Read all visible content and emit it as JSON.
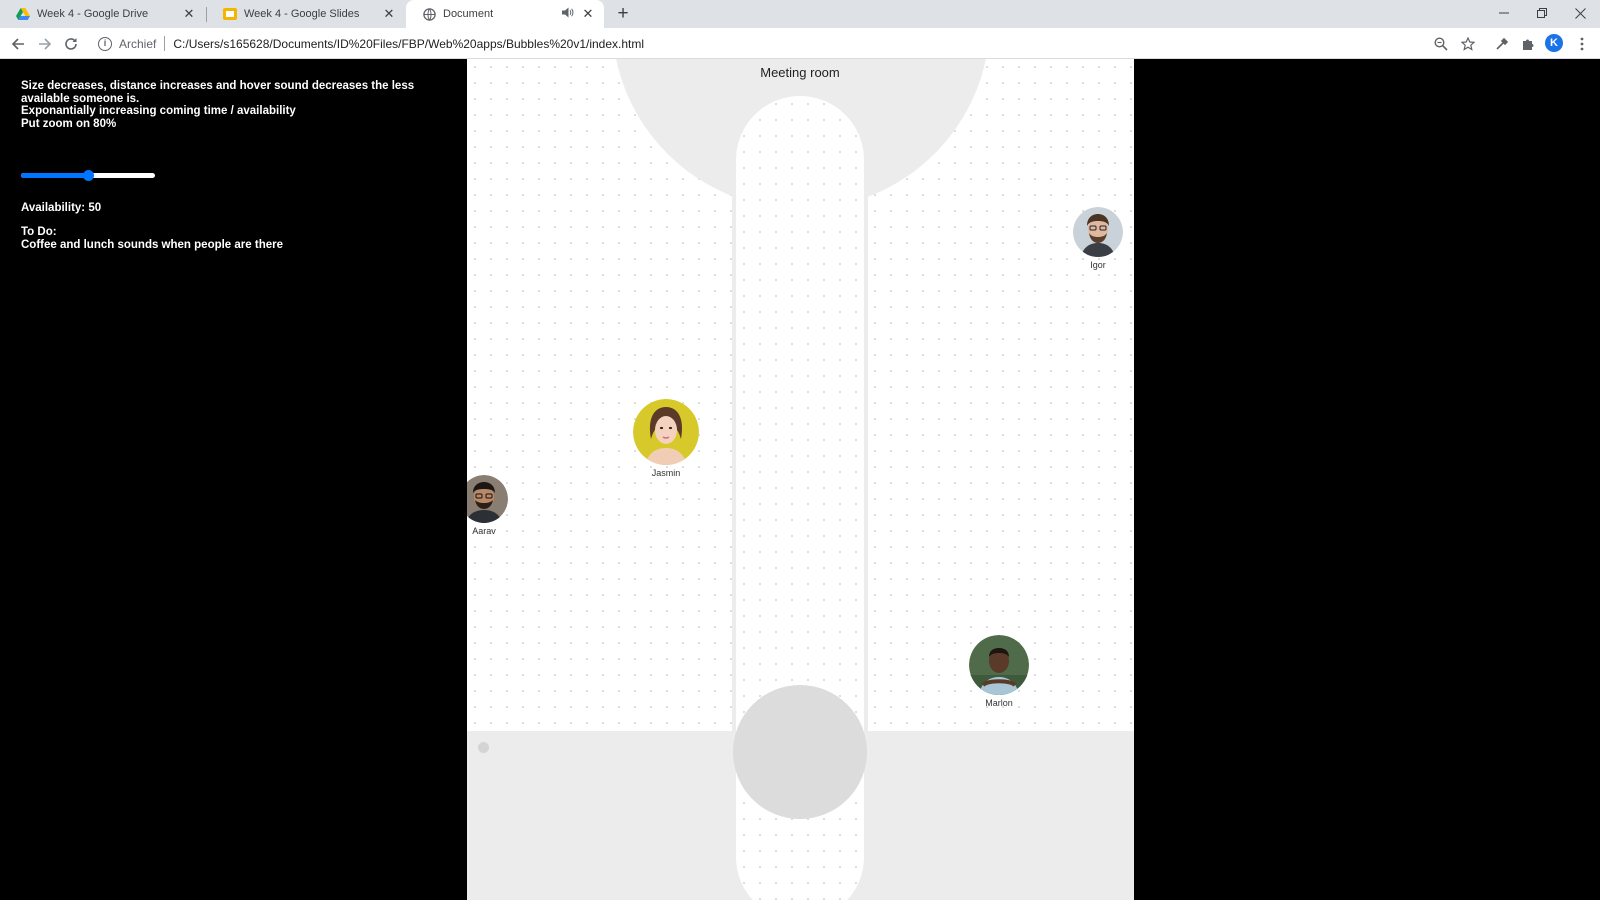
{
  "browser": {
    "tabs": [
      {
        "title": "Week 4 - Google Drive",
        "icon": "google-drive-icon",
        "active": false
      },
      {
        "title": "Week 4 - Google Slides",
        "icon": "google-slides-icon",
        "active": false
      },
      {
        "title": "Document",
        "icon": "globe-icon",
        "active": true
      }
    ],
    "address": {
      "security_label": "Archief",
      "url": "C:/Users/s165628/Documents/ID%20Files/FBP/Web%20apps/Bubbles%20v1/index.html"
    },
    "profile_initial": "K"
  },
  "info_panel": {
    "lines": [
      "Size decreases, distance increases and hover sound decreases the less available someone is.",
      "Exponantially increasing coming time / availability",
      "Put zoom on 80%"
    ]
  },
  "slider": {
    "value": 50,
    "min": 0,
    "max": 100
  },
  "availability_label": "Availability: 50",
  "todo": {
    "heading": "To Do:",
    "item": "Coffee and lunch sounds when people are there"
  },
  "map": {
    "room_title": "Meeting room",
    "people": [
      {
        "name": "Igor",
        "avatar": "man-glasses-beard-avatar"
      },
      {
        "name": "Jasmin",
        "avatar": "woman-yellow-background-avatar"
      },
      {
        "name": "Aarav",
        "avatar": "man-glasses-avatar"
      },
      {
        "name": "Marlon",
        "avatar": "man-outdoor-avatar"
      }
    ]
  },
  "colors": {
    "accent": "#0075ff",
    "page_bg": "#000000",
    "map_bg": "#ffffff",
    "room_gray": "#ececec",
    "jasmin_bg": "#d8c92a"
  }
}
